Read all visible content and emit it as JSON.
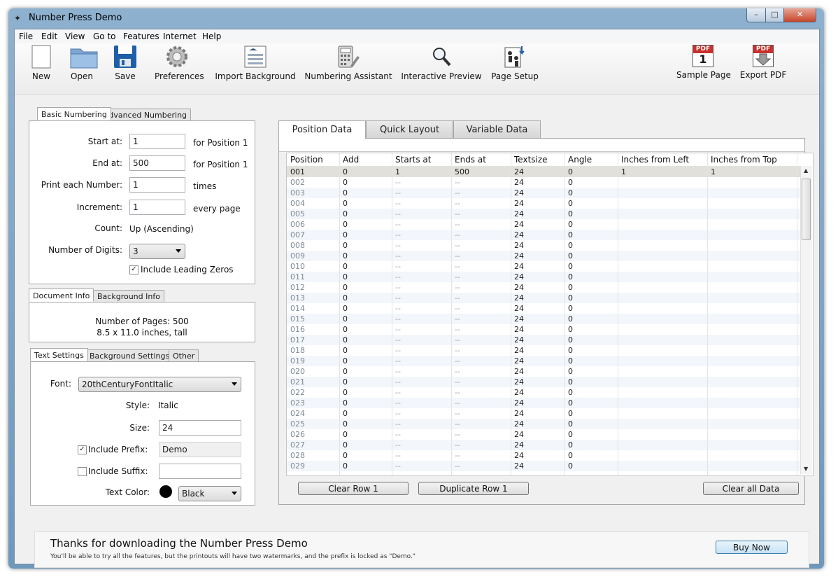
{
  "window": {
    "title": "Number Press Demo"
  },
  "menu": [
    "File",
    "Edit",
    "View",
    "Go to",
    "Features",
    "Internet",
    "Help"
  ],
  "toolbar": {
    "new": "New",
    "open": "Open",
    "save": "Save",
    "preferences": "Preferences",
    "import_background": "Import Background",
    "numbering_assistant": "Numbering Assistant",
    "interactive_preview": "Interactive Preview",
    "page_setup": "Page Setup",
    "sample_page": "Sample Page",
    "export_pdf": "Export PDF",
    "pdf_badge": "PDF",
    "page_badge": "1"
  },
  "numbering": {
    "tabs": [
      "Basic Numbering",
      "Advanced Numbering"
    ],
    "start_label": "Start at:",
    "start_value": "1",
    "start_suffix": "for Position 1",
    "end_label": "End at:",
    "end_value": "500",
    "end_suffix": "for Position 1",
    "print_label": "Print each Number:",
    "print_value": "1",
    "print_suffix": "times",
    "inc_label": "Increment:",
    "inc_value": "1",
    "inc_suffix": "every page",
    "count_label": "Count:",
    "count_value": "Up (Ascending)",
    "digits_label": "Number of Digits:",
    "digits_value": "3",
    "leading_zeros_label": "Include Leading Zeros",
    "leading_zeros_checked": true
  },
  "docinfo": {
    "tabs": [
      "Document Info",
      "Background Info"
    ],
    "pages": "Number of Pages: 500",
    "size": "8.5 x 11.0 inches, tall"
  },
  "text_settings": {
    "tabs": [
      "Text Settings",
      "Background Settings",
      "Other"
    ],
    "font_label": "Font:",
    "font_value": "20thCenturyFontItalic",
    "style_label": "Style:",
    "style_value": "Italic",
    "size_label": "Size:",
    "size_value": "24",
    "prefix_label": "Include Prefix:",
    "prefix_value": "Demo",
    "prefix_checked": true,
    "suffix_label": "Include Suffix:",
    "suffix_value": "",
    "suffix_checked": false,
    "color_label": "Text Color:",
    "color_value": "Black",
    "color_hex": "#000000"
  },
  "right_tabs": [
    "Position Data",
    "Quick Layout",
    "Variable Data"
  ],
  "grid": {
    "columns": [
      "Position",
      "Add",
      "Starts at",
      "Ends at",
      "Textsize",
      "Angle",
      "Inches from Left",
      "Inches from Top"
    ],
    "rows": [
      [
        "001",
        "0",
        "1",
        "500",
        "24",
        "0",
        "1",
        "1"
      ],
      [
        "002",
        "0",
        "--",
        "--",
        "24",
        "0",
        "",
        ""
      ],
      [
        "003",
        "0",
        "--",
        "--",
        "24",
        "0",
        "",
        ""
      ],
      [
        "004",
        "0",
        "--",
        "--",
        "24",
        "0",
        "",
        ""
      ],
      [
        "005",
        "0",
        "--",
        "--",
        "24",
        "0",
        "",
        ""
      ],
      [
        "006",
        "0",
        "--",
        "--",
        "24",
        "0",
        "",
        ""
      ],
      [
        "007",
        "0",
        "--",
        "--",
        "24",
        "0",
        "",
        ""
      ],
      [
        "008",
        "0",
        "--",
        "--",
        "24",
        "0",
        "",
        ""
      ],
      [
        "009",
        "0",
        "--",
        "--",
        "24",
        "0",
        "",
        ""
      ],
      [
        "010",
        "0",
        "--",
        "--",
        "24",
        "0",
        "",
        ""
      ],
      [
        "011",
        "0",
        "--",
        "--",
        "24",
        "0",
        "",
        ""
      ],
      [
        "012",
        "0",
        "--",
        "--",
        "24",
        "0",
        "",
        ""
      ],
      [
        "013",
        "0",
        "--",
        "--",
        "24",
        "0",
        "",
        ""
      ],
      [
        "014",
        "0",
        "--",
        "--",
        "24",
        "0",
        "",
        ""
      ],
      [
        "015",
        "0",
        "--",
        "--",
        "24",
        "0",
        "",
        ""
      ],
      [
        "016",
        "0",
        "--",
        "--",
        "24",
        "0",
        "",
        ""
      ],
      [
        "017",
        "0",
        "--",
        "--",
        "24",
        "0",
        "",
        ""
      ],
      [
        "018",
        "0",
        "--",
        "--",
        "24",
        "0",
        "",
        ""
      ],
      [
        "019",
        "0",
        "--",
        "--",
        "24",
        "0",
        "",
        ""
      ],
      [
        "020",
        "0",
        "--",
        "--",
        "24",
        "0",
        "",
        ""
      ],
      [
        "021",
        "0",
        "--",
        "--",
        "24",
        "0",
        "",
        ""
      ],
      [
        "022",
        "0",
        "--",
        "--",
        "24",
        "0",
        "",
        ""
      ],
      [
        "023",
        "0",
        "--",
        "--",
        "24",
        "0",
        "",
        ""
      ],
      [
        "024",
        "0",
        "--",
        "--",
        "24",
        "0",
        "",
        ""
      ],
      [
        "025",
        "0",
        "--",
        "--",
        "24",
        "0",
        "",
        ""
      ],
      [
        "026",
        "0",
        "--",
        "--",
        "24",
        "0",
        "",
        ""
      ],
      [
        "027",
        "0",
        "--",
        "--",
        "24",
        "0",
        "",
        ""
      ],
      [
        "028",
        "0",
        "--",
        "--",
        "24",
        "0",
        "",
        ""
      ],
      [
        "029",
        "0",
        "--",
        "--",
        "24",
        "0",
        "",
        ""
      ]
    ]
  },
  "grid_buttons": {
    "clear_row": "Clear Row 1",
    "duplicate_row": "Duplicate Row 1",
    "clear_all": "Clear all Data"
  },
  "banner": {
    "title": "Thanks for downloading the Number Press Demo",
    "subtitle": "You'll be able to try all the features, but the printouts will have two watermarks, and the prefix is locked as \"Demo.\"",
    "buy": "Buy Now"
  }
}
